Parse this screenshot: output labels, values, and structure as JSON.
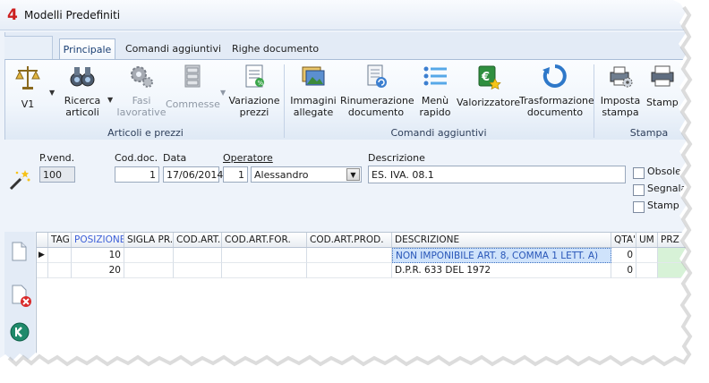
{
  "window": {
    "logo": "4",
    "title": "Modelli Predefiniti"
  },
  "tabs": [
    {
      "label": "Principale",
      "active": true
    },
    {
      "label": "Comandi aggiuntivi",
      "active": false
    },
    {
      "label": "Righe documento",
      "active": false
    }
  ],
  "ribbon": {
    "buttons": {
      "v1": "V1",
      "ricerca": [
        "Ricerca",
        "articoli"
      ],
      "fasi": [
        "Fasi",
        "lavorative"
      ],
      "commesse": "Commesse",
      "variazione": [
        "Variazione",
        "prezzi"
      ],
      "immagini": [
        "Immagini",
        "allegate"
      ],
      "rinumerazione": [
        "Rinumerazione",
        "documento"
      ],
      "menu": [
        "Menù",
        "rapido"
      ],
      "valorizzatore": "Valorizzatore",
      "trasformazione": [
        "Trasformazione",
        "documento"
      ],
      "imposta": [
        "Imposta",
        "stampa"
      ],
      "stampa": "Stamp"
    },
    "groups": {
      "articoli": "Articoli e prezzi",
      "comandi": "Comandi aggiuntivi",
      "stampa": "Stampa"
    }
  },
  "form": {
    "labels": {
      "pvend": "P.vend.",
      "coddoc": "Cod.doc.",
      "data": "Data",
      "operatore": "Operatore",
      "descrizione": "Descrizione"
    },
    "values": {
      "pvend": "100",
      "coddoc": "1",
      "data": "17/06/2014",
      "operatore_code": "1",
      "operatore_name": "Alessandro",
      "descrizione": "ES. IVA. 08.1"
    },
    "checkboxes": [
      "Obsole",
      "Segnala",
      "Stamp"
    ]
  },
  "grid": {
    "columns": [
      "TAG",
      "POSIZIONE",
      "SIGLA PR.",
      "COD.ART.",
      "COD.ART.FOR.",
      "COD.ART.PROD.",
      "DESCRIZIONE",
      "QTA'",
      "UM",
      "PRZ"
    ],
    "rows": [
      {
        "posizione": "10",
        "descrizione": "NON IMPONIBILE ART. 8, COMMA 1 LETT. A)",
        "qta": "0",
        "selected": true
      },
      {
        "posizione": "20",
        "descrizione": "D.P.R. 633 DEL 1972",
        "qta": "0",
        "selected": false
      }
    ]
  },
  "colors": {
    "accent_blue": "#3c7fd0",
    "logo_red": "#cc1f1f",
    "selection_bg": "#cfe3fb",
    "price_cell": "#d7f2d7"
  }
}
